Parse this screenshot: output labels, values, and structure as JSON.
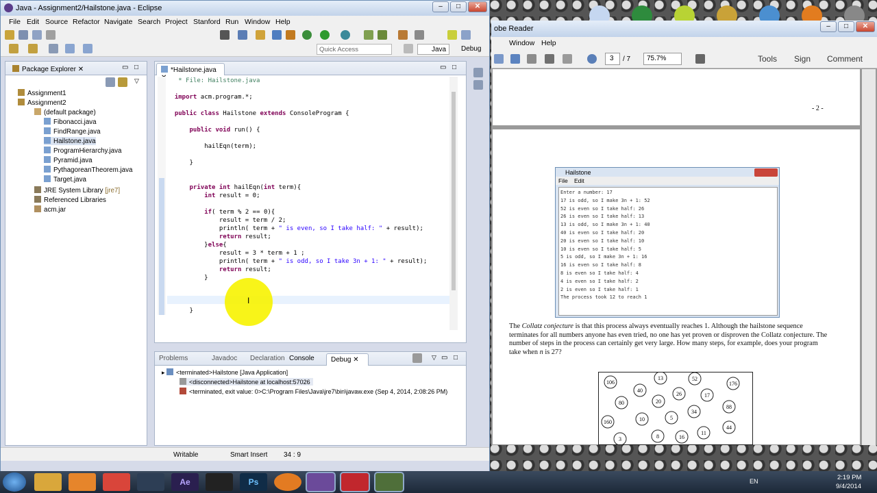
{
  "eclipse": {
    "title": "Java - Assignment2/Hailstone.java - Eclipse",
    "menu": [
      "File",
      "Edit",
      "Source",
      "Refactor",
      "Navigate",
      "Search",
      "Project",
      "Stanford",
      "Run",
      "Window",
      "Help"
    ],
    "quick_access": "Quick Access",
    "perspectives": [
      "Java",
      "Debug"
    ]
  },
  "package_explorer": {
    "tab": "Package Explorer",
    "items": [
      {
        "label": "Assignment1"
      },
      {
        "label": "Assignment2"
      },
      {
        "label": "(default package)"
      },
      {
        "label": "Fibonacci.java"
      },
      {
        "label": "FindRange.java"
      },
      {
        "label": "Hailstone.java"
      },
      {
        "label": "ProgramHierarchy.java"
      },
      {
        "label": "Pyramid.java"
      },
      {
        "label": "PythagoreanTheorem.java"
      },
      {
        "label": "Target.java"
      },
      {
        "label": "JRE System Library"
      },
      {
        "label": "Referenced Libraries"
      },
      {
        "label": "acm.jar"
      }
    ],
    "jre_suffix": "[jre7]"
  },
  "editor": {
    "tab": "*Hailstone.java",
    "lines": [
      "   * File: Hailstone.java",
      "",
      "  import acm.program.*;",
      "",
      "  public class Hailstone extends ConsoleProgram {",
      "",
      "      public void run() {",
      "",
      "          hailEqn(term);",
      "",
      "      }",
      "",
      "",
      "      private int hailEqn(int term){",
      "          int result = 0;",
      "",
      "          if( term % 2 == 0){",
      "              result = term / 2;",
      "              println( term + \" is even, so I take half: \" + result);",
      "              return result;",
      "          }else{",
      "              result = 3 * term + 1 ;",
      "              println( term + \" is odd, so I take 3n + 1: \" + result);",
      "              return result;",
      "          }",
      "",
      "",
      "",
      "      }"
    ]
  },
  "bottom": {
    "tabs": [
      "Problems",
      "Javadoc",
      "Declaration",
      "Console",
      "Debug"
    ],
    "rows": [
      "<terminated>Hailstone [Java Application]",
      "<disconnected>Hailstone at localhost:57026",
      "<terminated, exit value: 0>C:\\Program Files\\Java\\jre7\\bin\\javaw.exe (Sep 4, 2014, 2:08:26 PM)"
    ]
  },
  "status": {
    "mode": "Writable",
    "insert": "Smart Insert",
    "pos": "34 : 9"
  },
  "reader": {
    "title": "obe Reader",
    "menu": [
      "Window",
      "Help"
    ],
    "page": "3",
    "pages": "/ 7",
    "zoom": "75.7%",
    "tools": [
      "Tools",
      "Sign",
      "Comment"
    ],
    "page_marker": "- 2 -"
  },
  "hailstone_app": {
    "title": "Hailstone",
    "menu": [
      "File",
      "Edit"
    ],
    "lines": [
      "Enter a number: 17",
      "17 is odd, so I make 3n + 1: 52",
      "52 is even so I take half: 26",
      "26 is even so I take half: 13",
      "13 is odd, so I make 3n + 1: 40",
      "40 is even so I take half: 20",
      "20 is even so I take half: 10",
      "10 is even so I take half: 5",
      "5 is odd, so I make 3n + 1: 16",
      "16 is even so I take half: 8",
      "8 is even so I take half: 4",
      "4 is even so I take half: 2",
      "2 is even so I take half: 1",
      "The process took 12 to reach 1"
    ]
  },
  "pdf_text": {
    "p1": "The ",
    "em": "Collatz conjecture",
    "p2": " is that this process always eventually reaches 1. Although the hailstone sequence terminates for all numbers anyone has even tried, no one has yet proven or disproven the Collatz conjecture. The number of steps in the process can certainly get very large. How many steps, for example, does your program take when ",
    "n": "n",
    "p3": " is 27?"
  },
  "graph_nodes": [
    "106",
    "13",
    "52",
    "176",
    "40",
    "26",
    "17",
    "80",
    "20",
    "88",
    "160",
    "10",
    "5",
    "34",
    "3",
    "8",
    "16",
    "11",
    "44"
  ],
  "taskbar": {
    "lang": "EN",
    "time": "2:19 PM",
    "date": "9/4/2014"
  }
}
